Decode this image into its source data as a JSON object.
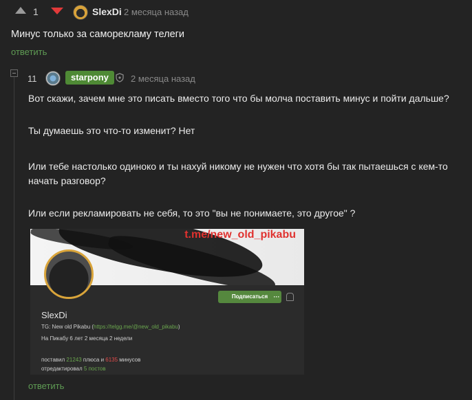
{
  "top_comment": {
    "rating": "1",
    "author": "SlexDi",
    "time": "2 месяца назад",
    "text": "Минус только за саморекламу телеги",
    "reply": "ответить"
  },
  "reply_comment": {
    "rating": "11",
    "author": "starpony",
    "time": "2 месяца назад",
    "paragraphs": [
      "Вот скажи, зачем мне это писать вместо того что бы молча поставить минус и пойти дальше?",
      "Ты думаешь это что-то изменит? Нет",
      "Или тебе настолько одиноко и ты нахуй никому не нужен что хотя бы так пытаешься с кем-то начать разговор?",
      "Или если рекламировать не себя, то это \"вы не понимаете, это другое\" ?"
    ],
    "reply": "ответить"
  },
  "embedded_image": {
    "banner_text": "t.me/new_old_pikabu",
    "subscribe_label": "Подписаться",
    "more_label": "···",
    "name": "SlexDi",
    "tg_prefix": "TG: New old Pikabu (",
    "tg_link": "https://telgg.me/@new_old_pikabu",
    "tg_suffix": ")",
    "since": "На Пикабу 6 лет 2 месяца 2 недели",
    "stats_prefix": "поставил ",
    "plus_count": "21243",
    "stats_mid": " плюса и ",
    "minus_count": "6135",
    "stats_suffix": " минусов",
    "edit_prefix": "отредактировал ",
    "edit_count": "5 постов"
  },
  "colors": {
    "background": "#232323",
    "accent_green": "#5f9c54",
    "downvote_red": "#e23a3a",
    "badge_green": "#4f8a35"
  }
}
